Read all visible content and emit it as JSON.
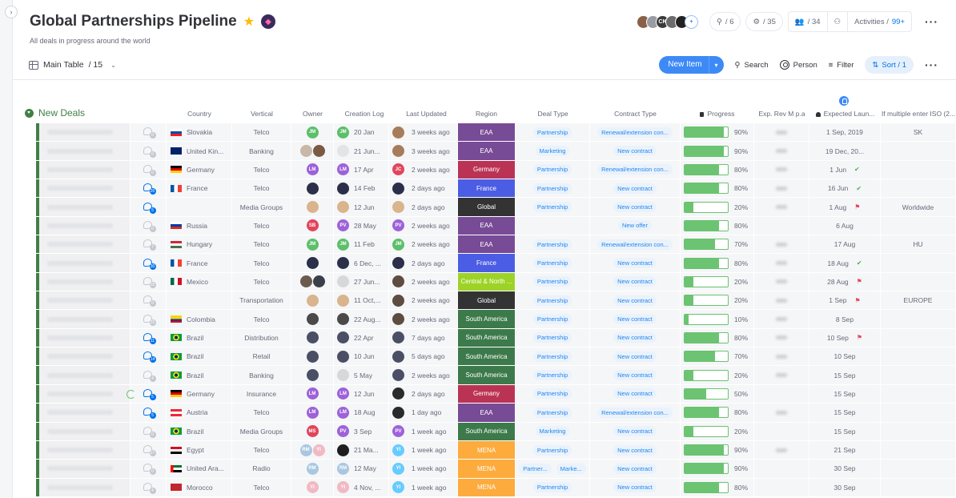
{
  "board": {
    "title": "Global Partnerships Pipeline",
    "description": "All deals in progress around the world",
    "view": {
      "label": "Main Table",
      "count": "/ 15"
    }
  },
  "header": {
    "members": [
      {
        "initials": "",
        "color": "#8a6048"
      },
      {
        "initials": "",
        "color": "#9a9ca3"
      },
      {
        "initials": "CK",
        "color": "#3a3a3a"
      },
      {
        "initials": "",
        "color": "#6c6c6c"
      },
      {
        "initials": "",
        "color": "#222222"
      }
    ],
    "integrations_count": "/ 6",
    "automations_count": "/ 35",
    "people_count": "/ 34",
    "activities_label": "Activities /",
    "activities_count": "99+"
  },
  "toolbar": {
    "new_item": "New Item",
    "search": "Search",
    "person": "Person",
    "filter": "Filter",
    "sort": "Sort / 1"
  },
  "group": {
    "title": "New Deals",
    "color": "#418045",
    "columns": {
      "country": "Country",
      "vertical": "Vertical",
      "owner": "Owner",
      "creation_log": "Creation Log",
      "last_updated": "Last Updated",
      "region": "Region",
      "deal_type": "Deal Type",
      "contract_type": "Contract Type",
      "progress": "Progress",
      "exp_rev": "Exp. Rev M p.a",
      "expected_launch": "Expected Laun...",
      "iso": "If multiple enter ISO (2..."
    }
  },
  "rows": [
    {
      "updates": "0",
      "active": false,
      "country": "Slovakia",
      "flag": "sk",
      "vertical": "Telco",
      "owner": [
        {
          "i": "JM",
          "c": "#5cbf6a"
        }
      ],
      "clog_av": {
        "i": "JM",
        "c": "#5cbf6a"
      },
      "clog": "20 Jan",
      "lupd_av": {
        "i": "",
        "c": "#a77c5a"
      },
      "lupd": "3 weeks ago",
      "region": "EAA",
      "region_color": "#784b96",
      "deal": [
        "Partnership"
      ],
      "contract": "Renewal/extension con...",
      "progress": 90,
      "rev": true,
      "exp": "1 Sep, 2019",
      "status": "",
      "iso": "SK"
    },
    {
      "updates": "0",
      "active": false,
      "country": "United Kin...",
      "flag": "gb",
      "vertical": "Banking",
      "owner": [
        {
          "i": "",
          "c": "#c9b7a8"
        },
        {
          "i": "",
          "c": "#7a5a44"
        }
      ],
      "clog_av": {
        "i": "",
        "c": "#e3e4e8"
      },
      "clog": "21 Jun...",
      "lupd_av": {
        "i": "",
        "c": "#a77c5a"
      },
      "lupd": "3 weeks ago",
      "region": "EAA",
      "region_color": "#784b96",
      "deal": [
        "Marketing"
      ],
      "contract": "New contract",
      "progress": 90,
      "rev": true,
      "exp": "19 Dec, 20...",
      "status": "",
      "iso": ""
    },
    {
      "updates": "0",
      "active": false,
      "country": "Germany",
      "flag": "de",
      "vertical": "Telco",
      "owner": [
        {
          "i": "LM",
          "c": "#9d62d9"
        }
      ],
      "clog_av": {
        "i": "LM",
        "c": "#9d62d9"
      },
      "clog": "17 Apr",
      "lupd_av": {
        "i": "JC",
        "c": "#e2445c"
      },
      "lupd": "2 weeks ago",
      "region": "Germany",
      "region_color": "#bb3354",
      "deal": [
        "Partnership"
      ],
      "contract": "Renewal/extension con...",
      "progress": 80,
      "rev": true,
      "exp": "1 Jun",
      "status": "check",
      "iso": ""
    },
    {
      "updates": "20",
      "active": true,
      "country": "France",
      "flag": "fr",
      "vertical": "Telco",
      "owner": [
        {
          "i": "",
          "c": "#2b2f4a"
        }
      ],
      "clog_av": {
        "i": "",
        "c": "#2b2f4a"
      },
      "clog": "14 Feb",
      "lupd_av": {
        "i": "",
        "c": "#2b2f4a"
      },
      "lupd": "2 days ago",
      "region": "France",
      "region_color": "#4b5de4",
      "deal": [
        "Partnership"
      ],
      "contract": "New contract",
      "progress": 80,
      "rev": true,
      "exp": "16 Jun",
      "status": "check",
      "iso": ""
    },
    {
      "updates": "5",
      "active": true,
      "country": "",
      "flag": "",
      "vertical": "Media Groups",
      "owner": [
        {
          "i": "",
          "c": "#d9b48c"
        }
      ],
      "clog_av": {
        "i": "",
        "c": "#d9b48c"
      },
      "clog": "12 Jun",
      "lupd_av": {
        "i": "",
        "c": "#d9b48c"
      },
      "lupd": "2 days ago",
      "region": "Global",
      "region_color": "#333333",
      "deal": [
        "Partnership"
      ],
      "contract": "New contract",
      "progress": 20,
      "rev": true,
      "exp": "1 Aug",
      "status": "stuck",
      "iso": "Worldwide"
    },
    {
      "updates": "0",
      "active": false,
      "country": "Russia",
      "flag": "ru",
      "vertical": "Telco",
      "owner": [
        {
          "i": "SB",
          "c": "#e2445c"
        }
      ],
      "clog_av": {
        "i": "PV",
        "c": "#9d62d9"
      },
      "clog": "28 May",
      "lupd_av": {
        "i": "PV",
        "c": "#9d62d9"
      },
      "lupd": "2 weeks ago",
      "region": "EAA",
      "region_color": "#784b96",
      "deal": [],
      "contract": "New offer",
      "progress": 80,
      "rev": false,
      "exp": "6 Aug",
      "status": "",
      "iso": ""
    },
    {
      "updates": "7",
      "active": false,
      "country": "Hungary",
      "flag": "hu",
      "vertical": "Telco",
      "owner": [
        {
          "i": "JM",
          "c": "#5cbf6a"
        }
      ],
      "clog_av": {
        "i": "JM",
        "c": "#5cbf6a"
      },
      "clog": "11 Feb",
      "lupd_av": {
        "i": "JM",
        "c": "#5cbf6a"
      },
      "lupd": "2 weeks ago",
      "region": "EAA",
      "region_color": "#784b96",
      "deal": [
        "Partnership"
      ],
      "contract": "Renewal/extension con...",
      "progress": 70,
      "rev": true,
      "exp": "17 Aug",
      "status": "",
      "iso": "HU"
    },
    {
      "updates": "30",
      "active": true,
      "country": "France",
      "flag": "fr",
      "vertical": "Telco",
      "owner": [
        {
          "i": "",
          "c": "#2b2f4a"
        }
      ],
      "clog_av": {
        "i": "",
        "c": "#2b2f4a"
      },
      "clog": "6 Dec, ...",
      "lupd_av": {
        "i": "",
        "c": "#2b2f4a"
      },
      "lupd": "2 days ago",
      "region": "France",
      "region_color": "#4b5de4",
      "deal": [
        "Partnership"
      ],
      "contract": "New contract",
      "progress": 80,
      "rev": true,
      "exp": "18 Aug",
      "status": "check",
      "iso": ""
    },
    {
      "updates": "25",
      "active": false,
      "country": "Mexico",
      "flag": "mx",
      "vertical": "Telco",
      "owner": [
        {
          "i": "",
          "c": "#6b5a4e"
        },
        {
          "i": "",
          "c": "#3a3f4a"
        }
      ],
      "clog_av": {
        "i": "",
        "c": "#d7d8dc"
      },
      "clog": "27 Jun...",
      "lupd_av": {
        "i": "",
        "c": "#5e4c40"
      },
      "lupd": "2 weeks ago",
      "region": "Central & North ...",
      "region_color": "#9cd326",
      "deal": [
        "Partnership"
      ],
      "contract": "New contract",
      "progress": 20,
      "rev": true,
      "exp": "28 Aug",
      "status": "stuck",
      "iso": ""
    },
    {
      "updates": "0",
      "active": false,
      "country": "",
      "flag": "",
      "vertical": "Transportation",
      "owner": [
        {
          "i": "",
          "c": "#d9b48c"
        }
      ],
      "clog_av": {
        "i": "",
        "c": "#d9b48c"
      },
      "clog": "11 Oct,...",
      "lupd_av": {
        "i": "",
        "c": "#5e4c40"
      },
      "lupd": "2 weeks ago",
      "region": "Global",
      "region_color": "#333333",
      "deal": [
        "Partnership"
      ],
      "contract": "New contract",
      "progress": 20,
      "rev": true,
      "exp": "1 Sep",
      "status": "stuck",
      "iso": "EUROPE"
    },
    {
      "updates": "25",
      "active": false,
      "country": "Colombia",
      "flag": "co",
      "vertical": "Telco",
      "owner": [
        {
          "i": "",
          "c": "#4a4a4a"
        }
      ],
      "clog_av": {
        "i": "",
        "c": "#4a4a4a"
      },
      "clog": "22 Aug...",
      "lupd_av": {
        "i": "",
        "c": "#5e4c40"
      },
      "lupd": "2 weeks ago",
      "region": "South America",
      "region_color": "#3d7a4b",
      "deal": [
        "Partnership"
      ],
      "contract": "New contract",
      "progress": 10,
      "rev": true,
      "exp": "8 Sep",
      "status": "",
      "iso": ""
    },
    {
      "updates": "11",
      "active": true,
      "country": "Brazil",
      "flag": "br",
      "vertical": "Distribution",
      "owner": [
        {
          "i": "",
          "c": "#4b4f66"
        }
      ],
      "clog_av": {
        "i": "",
        "c": "#4b4f66"
      },
      "clog": "22 Apr",
      "lupd_av": {
        "i": "",
        "c": "#4b4f66"
      },
      "lupd": "7 days ago",
      "region": "South America",
      "region_color": "#3d7a4b",
      "deal": [
        "Partnership"
      ],
      "contract": "New contract",
      "progress": 80,
      "rev": true,
      "exp": "10 Sep",
      "status": "stuck",
      "iso": ""
    },
    {
      "updates": "14",
      "active": true,
      "country": "Brazil",
      "flag": "br",
      "vertical": "Retail",
      "owner": [
        {
          "i": "",
          "c": "#4b4f66"
        }
      ],
      "clog_av": {
        "i": "",
        "c": "#4b4f66"
      },
      "clog": "10 Jun",
      "lupd_av": {
        "i": "",
        "c": "#4b4f66"
      },
      "lupd": "5 days ago",
      "region": "South America",
      "region_color": "#3d7a4b",
      "deal": [
        "Partnership"
      ],
      "contract": "New contract",
      "progress": 70,
      "rev": true,
      "exp": "10 Sep",
      "status": "",
      "iso": ""
    },
    {
      "updates": "4",
      "active": false,
      "country": "Brazil",
      "flag": "br",
      "vertical": "Banking",
      "owner": [
        {
          "i": "",
          "c": "#4b4f66"
        }
      ],
      "clog_av": {
        "i": "",
        "c": "#d7d8dc"
      },
      "clog": "5 May",
      "lupd_av": {
        "i": "",
        "c": "#4b4f66"
      },
      "lupd": "2 weeks ago",
      "region": "South America",
      "region_color": "#3d7a4b",
      "deal": [
        "Partnership"
      ],
      "contract": "New contract",
      "progress": 20,
      "rev": true,
      "exp": "15 Sep",
      "status": "",
      "iso": ""
    },
    {
      "updates": "5",
      "active": true,
      "ring": true,
      "country": "Germany",
      "flag": "de",
      "vertical": "Insurance",
      "owner": [
        {
          "i": "LM",
          "c": "#9d62d9"
        }
      ],
      "clog_av": {
        "i": "LM",
        "c": "#9d62d9"
      },
      "clog": "12 Jun",
      "lupd_av": {
        "i": "",
        "c": "#2a2a2a"
      },
      "lupd": "2 days ago",
      "region": "Germany",
      "region_color": "#bb3354",
      "deal": [
        "Partnership"
      ],
      "contract": "New contract",
      "progress": 50,
      "rev": false,
      "exp": "15 Sep",
      "status": "",
      "iso": ""
    },
    {
      "updates": "5",
      "active": true,
      "country": "Austria",
      "flag": "at",
      "vertical": "Telco",
      "owner": [
        {
          "i": "LM",
          "c": "#9d62d9"
        }
      ],
      "clog_av": {
        "i": "LM",
        "c": "#9d62d9"
      },
      "clog": "18 Aug",
      "lupd_av": {
        "i": "",
        "c": "#2a2a2a"
      },
      "lupd": "1 day ago",
      "region": "EAA",
      "region_color": "#784b96",
      "deal": [
        "Partnership"
      ],
      "contract": "Renewal/extension con...",
      "progress": 80,
      "rev": true,
      "exp": "15 Sep",
      "status": "",
      "iso": ""
    },
    {
      "updates": "0",
      "active": false,
      "country": "Brazil",
      "flag": "br",
      "vertical": "Media Groups",
      "owner": [
        {
          "i": "MS",
          "c": "#e2445c"
        }
      ],
      "clog_av": {
        "i": "PV",
        "c": "#9d62d9"
      },
      "clog": "3 Sep",
      "lupd_av": {
        "i": "PV",
        "c": "#9d62d9"
      },
      "lupd": "1 week ago",
      "region": "South America",
      "region_color": "#3d7a4b",
      "deal": [
        "Marketing"
      ],
      "contract": "New contract",
      "progress": 20,
      "rev": false,
      "exp": "15 Sep",
      "status": "",
      "iso": ""
    },
    {
      "updates": "27",
      "active": false,
      "country": "Egypt",
      "flag": "eg",
      "vertical": "Telco",
      "owner": [
        {
          "i": "RM",
          "c": "#a9c7df"
        },
        {
          "i": "YI",
          "c": "#f1b9c4"
        }
      ],
      "clog_av": {
        "i": "",
        "c": "#1f1f1f"
      },
      "clog": "21 Ma...",
      "lupd_av": {
        "i": "YI",
        "c": "#66ccff"
      },
      "lupd": "1 week ago",
      "region": "MENA",
      "region_color": "#fdab3d",
      "deal": [
        "Partnership"
      ],
      "contract": "New contract",
      "progress": 90,
      "rev": true,
      "exp": "21 Sep",
      "status": "",
      "iso": ""
    },
    {
      "updates": "0",
      "active": false,
      "country": "United Ara...",
      "flag": "ae",
      "vertical": "Radio",
      "owner": [
        {
          "i": "RM",
          "c": "#a9c7df"
        }
      ],
      "clog_av": {
        "i": "RM",
        "c": "#a9c7df"
      },
      "clog": "12 May",
      "lupd_av": {
        "i": "YI",
        "c": "#66ccff"
      },
      "lupd": "1 week ago",
      "region": "MENA",
      "region_color": "#fdab3d",
      "deal": [
        "Partner...",
        "Marke..."
      ],
      "contract": "New contract",
      "progress": 90,
      "rev": false,
      "exp": "30 Sep",
      "status": "",
      "iso": ""
    },
    {
      "updates": "4",
      "active": false,
      "country": "Morocco",
      "flag": "ma",
      "vertical": "Telco",
      "owner": [
        {
          "i": "YI",
          "c": "#f1b9c4"
        }
      ],
      "clog_av": {
        "i": "YI",
        "c": "#f1b9c4"
      },
      "clog": "4 Nov, ...",
      "lupd_av": {
        "i": "YI",
        "c": "#66ccff"
      },
      "lupd": "1 week ago",
      "region": "MENA",
      "region_color": "#fdab3d",
      "deal": [
        "Partnership"
      ],
      "contract": "New contract",
      "progress": 80,
      "rev": false,
      "exp": "30 Sep",
      "status": "",
      "iso": ""
    }
  ]
}
